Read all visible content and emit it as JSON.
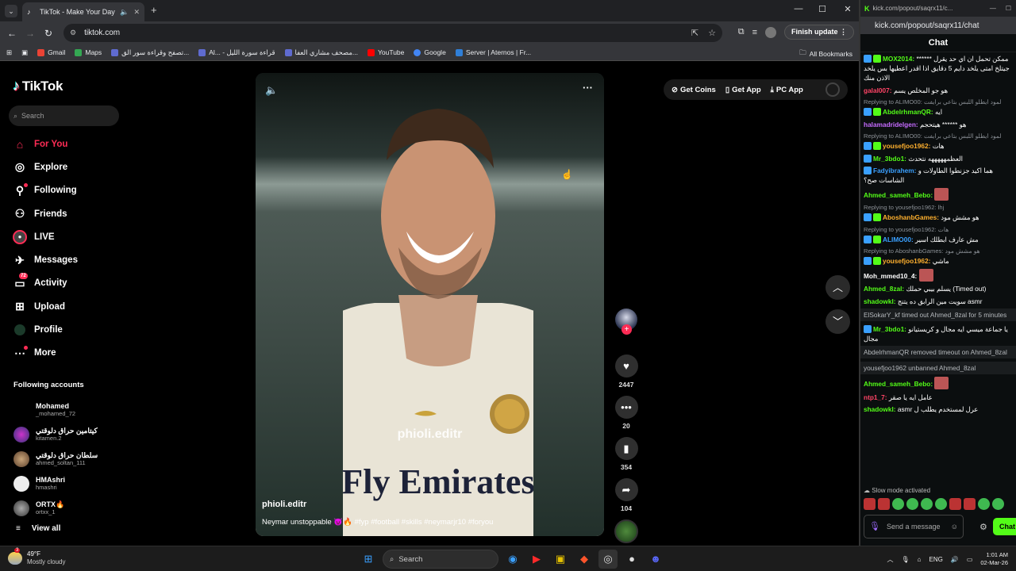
{
  "browser": {
    "tab_title": "TikTok - Make Your Day",
    "url": "tiktok.com",
    "finish_update": "Finish update",
    "bookmarks": [
      {
        "label": "Gmail",
        "color": "#ea4335"
      },
      {
        "label": "Maps",
        "color": "#34a853"
      },
      {
        "label": "تصفح وقراءة سور الق...",
        "color": "#5f6bd0"
      },
      {
        "label": "Al... - قراءة سورة الليل",
        "color": "#5f6bd0"
      },
      {
        "label": "مصحف مشاري العفا...",
        "color": "#5f6bd0"
      },
      {
        "label": "YouTube",
        "color": "#ff0000"
      },
      {
        "label": "Google",
        "color": "#4285f4"
      },
      {
        "label": "Server | Aternos | Fr...",
        "color": "#2f7fd8"
      }
    ],
    "all_bookmarks": "All Bookmarks"
  },
  "tiktok": {
    "logo": "TikTok",
    "search_placeholder": "Search",
    "menu": [
      {
        "label": "For You",
        "icon": "home-icon"
      },
      {
        "label": "Explore",
        "icon": "compass-icon"
      },
      {
        "label": "Following",
        "icon": "following-icon"
      },
      {
        "label": "Friends",
        "icon": "friends-icon"
      },
      {
        "label": "LIVE",
        "icon": "live-icon"
      },
      {
        "label": "Messages",
        "icon": "messages-icon"
      },
      {
        "label": "Activity",
        "icon": "activity-icon",
        "badge": "72"
      },
      {
        "label": "Upload",
        "icon": "upload-icon"
      },
      {
        "label": "Profile",
        "icon": "profile-icon"
      },
      {
        "label": "More",
        "icon": "more-icon"
      }
    ],
    "following_title": "Following accounts",
    "following": [
      {
        "name": "Mohamed",
        "handle": "_mohamed_72"
      },
      {
        "name": "كيتامين حراق دلوقتي",
        "handle": "kitamen.2"
      },
      {
        "name": "سلطان حراق دلوقتي",
        "handle": "ahmed_soltan_111"
      },
      {
        "name": "HMAshri",
        "handle": "hmashri"
      },
      {
        "name": "ORTX🔥",
        "handle": "ortxx_1"
      }
    ],
    "view_all": "View all",
    "top": {
      "coins": "Get Coins",
      "app": "Get App",
      "pc": "PC App"
    },
    "video": {
      "watermark": "phioli.editr",
      "username": "phioli.editr",
      "caption": "Neymar unstoppable 😈🔥 #fyp #football #skills #neymarjr10 #foryou",
      "jersey_text": "Fly Emirates"
    },
    "actions": {
      "likes": "2447",
      "comments": "20",
      "saves": "354",
      "shares": "104"
    }
  },
  "kick": {
    "window_url": "kick.com/popout/saqrx11/c...",
    "url": "kick.com/popout/saqrx11/chat",
    "header": "Chat",
    "messages": [
      {
        "type": "msg",
        "user": "MOX2014:",
        "color": "#53fc18",
        "badges": 2,
        "text": "ممكن تحمل ان اي حد يقرل ****** جيتلخ امتى يلخد دايم 5 دقايق اذا اقدر اعطيها بس يلخد الاذن منك"
      },
      {
        "type": "msg",
        "user": "galal007:",
        "color": "#ff4466",
        "badges": 0,
        "text": "هو جو المخلص يسم"
      },
      {
        "type": "reply",
        "text": "Replying to ALIMO00: لمود ايطلو اللبس بتاعي برايفت"
      },
      {
        "type": "msg",
        "user": "AbdelrhmanQR:",
        "color": "#53fc18",
        "badges": 2,
        "text": "ايه"
      },
      {
        "type": "msg",
        "user": "halamadridelgen:",
        "color": "#c56bff",
        "badges": 0,
        "text": "هو ****** هيتحجم"
      },
      {
        "type": "reply",
        "text": "Replying to ALIMO00: لمود ايطلو اللبس بتاعي برايفت"
      },
      {
        "type": "msg",
        "user": "yousefjoo1962:",
        "color": "#ffb02e",
        "badges": 2,
        "text": "هات"
      },
      {
        "type": "msg",
        "user": "Mr_3bdo1:",
        "color": "#53fc18",
        "badges": 1,
        "text": "العظمهههههه نتحدث"
      },
      {
        "type": "msg",
        "user": "Fadyibrahem:",
        "color": "#3aa0ff",
        "badges": 1,
        "text": "هما اكيد جزنطوا الطاولات و الشاسات صح؟"
      },
      {
        "type": "msg",
        "user": "Ahmed_sameh_Bebo:",
        "color": "#53fc18",
        "badges": 0,
        "text": ""
      },
      {
        "type": "reply",
        "text": "Replying to yousefjoo1962: lhj"
      },
      {
        "type": "msg",
        "user": "AboshanbGames:",
        "color": "#ffb02e",
        "badges": 2,
        "text": "هو مشش مود"
      },
      {
        "type": "reply",
        "text": "Replying to yousefjoo1962: هات"
      },
      {
        "type": "msg",
        "user": "ALIMO00:",
        "color": "#3aa0ff",
        "badges": 2,
        "text": "مش عارف ابطلك اسير"
      },
      {
        "type": "reply",
        "text": "Replying to AboshanbGames: هو مشش مود"
      },
      {
        "type": "msg",
        "user": "yousefjoo1962:",
        "color": "#ffb02e",
        "badges": 2,
        "text": "ماشي"
      },
      {
        "type": "msg",
        "user": "Moh_mmed10_4:",
        "color": "#ffffff",
        "badges": 0,
        "text": ""
      },
      {
        "type": "msg",
        "user": "Ahmed_8zal:",
        "color": "#53fc18",
        "badges": 0,
        "text": "يسلم بيبي حملك (Timed out)"
      },
      {
        "type": "msg",
        "user": "shadowkl:",
        "color": "#53fc18",
        "badges": 0,
        "text": "سويت مين الرابق ده يتنج asmr"
      },
      {
        "type": "sys",
        "text": "ElSokarY_kf timed out Ahmed_8zal for 5 minutes"
      },
      {
        "type": "msg",
        "user": "Mr_3bdo1:",
        "color": "#53fc18",
        "badges": 1,
        "text": "يا جماعة ميسي ايه مجال و كريستيانو مجال"
      },
      {
        "type": "sys",
        "text": "AbdelrhmanQR removed timeout on Ahmed_8zal"
      },
      {
        "type": "sys",
        "text": "yousefjoo1962 unbanned Ahmed_8zal"
      },
      {
        "type": "msg",
        "user": "Ahmed_sameh_Bebo:",
        "color": "#53fc18",
        "badges": 0,
        "text": ""
      },
      {
        "type": "msg",
        "user": "ntp1_7:",
        "color": "#ff4466",
        "badges": 0,
        "text": "عامل ايه يا صقر"
      },
      {
        "type": "msg",
        "user": "shadowkl:",
        "color": "#53fc18",
        "badges": 0,
        "text": "asmr عرل لمستخدم يطلب ل"
      }
    ],
    "slow_mode": "Slow mode activated",
    "send_placeholder": "Send a message",
    "chat_button": "Chat"
  },
  "taskbar": {
    "temp": "49°F",
    "weather": "Mostly cloudy",
    "search": "Search",
    "lang": "ENG",
    "time": "1:01 AM",
    "date": "02-Mar-26"
  }
}
